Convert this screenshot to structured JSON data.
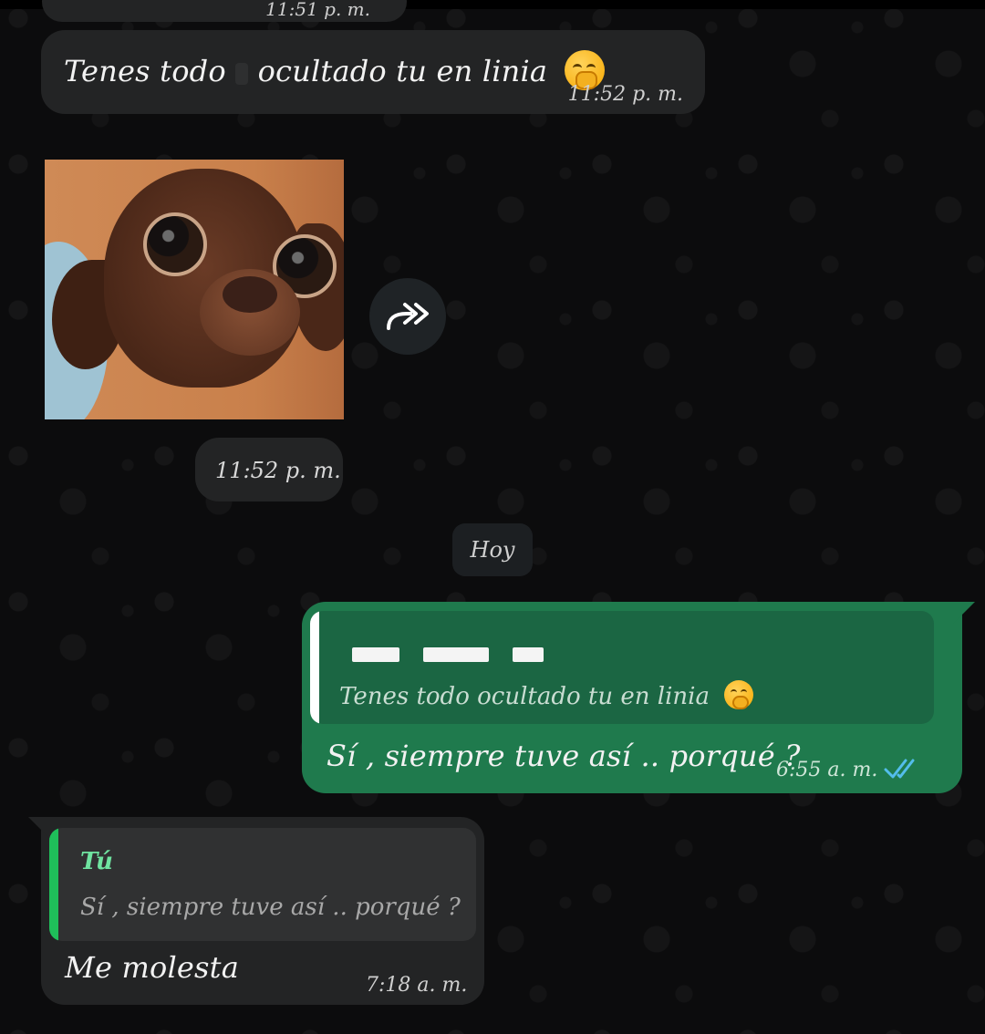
{
  "chat": {
    "top_cutoff_time": "11:51 p. m.",
    "incoming_message_1": {
      "text_before": "Tenes todo",
      "text_after": "ocultado tu en linia",
      "emoji_icon": "face-with-hand-over-mouth",
      "time": "11:52 p. m."
    },
    "sticker_message": {
      "icon": "chihuahua-sticker",
      "forward_icon": "double-forward-arrow",
      "time": "11:52 p. m."
    },
    "date_separator": "Hoy",
    "outgoing_message": {
      "quoted_text_before": "Tenes todo",
      "quoted_text_after": "ocultado tu en linia",
      "text": "Sí , siempre tuve así .. porqué ?",
      "time": "6:55 a. m.",
      "status_icon": "read-double-check",
      "accent_color": "#53bdeb"
    },
    "incoming_message_2": {
      "quoted_author": "Tú",
      "quoted_text": "Sí , siempre tuve así .. porqué ?",
      "text": "Me molesta",
      "time": "7:18 a. m."
    }
  },
  "colors": {
    "incoming_bubble": "#232425",
    "outgoing_bubble": "#1f7a4d",
    "quote_accent_green": "#1fbf5a"
  }
}
